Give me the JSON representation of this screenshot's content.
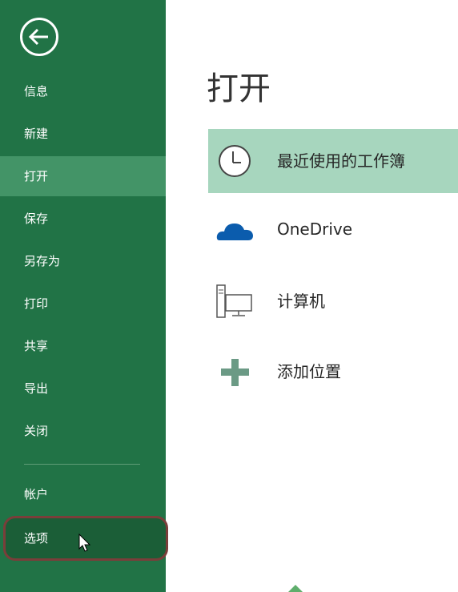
{
  "sidebar": {
    "back_icon": "back-arrow-icon",
    "items": [
      {
        "label": "信息",
        "icon": ""
      },
      {
        "label": "新建",
        "icon": ""
      },
      {
        "label": "打开",
        "icon": ""
      },
      {
        "label": "保存",
        "icon": ""
      },
      {
        "label": "另存为",
        "icon": ""
      },
      {
        "label": "打印",
        "icon": ""
      },
      {
        "label": "共享",
        "icon": ""
      },
      {
        "label": "导出",
        "icon": ""
      },
      {
        "label": "关闭",
        "icon": ""
      },
      {
        "label": "帐户",
        "icon": ""
      },
      {
        "label": "选项",
        "icon": ""
      }
    ],
    "active_item": "打开",
    "highlighted_item": "选项"
  },
  "main": {
    "title": "打开",
    "options": [
      {
        "label": "最近使用的工作簿",
        "icon": "clock-icon"
      },
      {
        "label": "OneDrive",
        "icon": "cloud-icon"
      },
      {
        "label": "计算机",
        "icon": "computer-icon"
      },
      {
        "label": "添加位置",
        "icon": "plus-icon"
      }
    ]
  },
  "colors": {
    "sidebar_bg": "#217346",
    "sidebar_active": "#439467",
    "option_active": "#a7d6be",
    "highlight_ring": "#7a3e3a"
  }
}
